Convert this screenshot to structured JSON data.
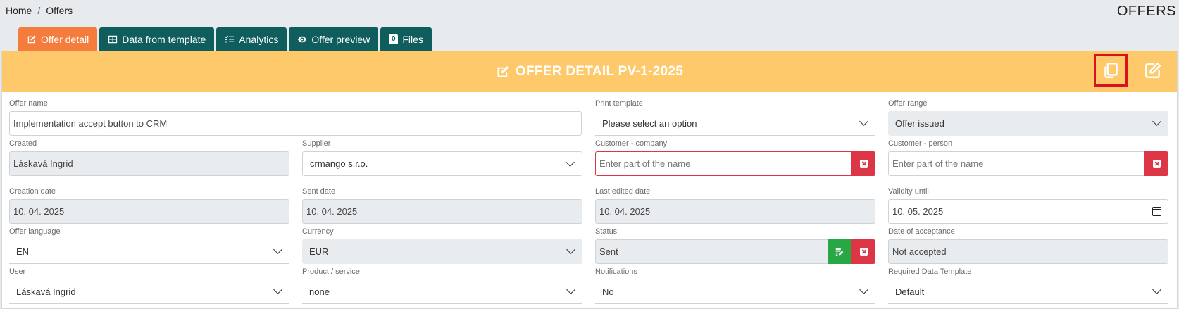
{
  "breadcrumb": {
    "home": "Home",
    "separator": "/",
    "current": "Offers"
  },
  "page_title": "OFFERS",
  "tabs": [
    {
      "label": "Offer detail",
      "icon": "edit-icon",
      "active": true
    },
    {
      "label": "Data from template",
      "icon": "table-icon",
      "active": false
    },
    {
      "label": "Analytics",
      "icon": "list-check-icon",
      "active": false
    },
    {
      "label": "Offer preview",
      "icon": "eye-icon",
      "active": false
    },
    {
      "label": "Files",
      "icon": "files-badge",
      "badge": "0",
      "active": false
    }
  ],
  "header": {
    "title": "OFFER DETAIL PV-1-2025",
    "background": "#fec96a",
    "actions": [
      {
        "icon": "copy-icon",
        "focused": true
      },
      {
        "icon": "external-edit-icon",
        "focused": false
      }
    ]
  },
  "form": {
    "offer_name": {
      "label": "Offer name",
      "value": "Implementation accept button to CRM"
    },
    "print_template": {
      "label": "Print template",
      "value": "Please select an option"
    },
    "offer_range": {
      "label": "Offer range",
      "value": "Offer issued"
    },
    "created": {
      "label": "Created",
      "value": "Láskavá Ingrid"
    },
    "supplier": {
      "label": "Supplier",
      "value": "crmango s.r.o."
    },
    "customer_company": {
      "label": "Customer - company",
      "placeholder": "Enter part of the name"
    },
    "customer_person": {
      "label": "Customer - person",
      "placeholder": "Enter part of the name"
    },
    "creation_date": {
      "label": "Creation date",
      "value": "10. 04. 2025"
    },
    "sent_date": {
      "label": "Sent date",
      "value": "10. 04. 2025"
    },
    "last_edited_date": {
      "label": "Last edited date",
      "value": "10. 04. 2025"
    },
    "validity_until": {
      "label": "Validity until",
      "value": "10. 05. 2025"
    },
    "offer_language": {
      "label": "Offer language",
      "value": "EN"
    },
    "currency": {
      "label": "Currency",
      "value": "EUR"
    },
    "status": {
      "label": "Status",
      "value": "Sent"
    },
    "date_of_acceptance": {
      "label": "Date of acceptance",
      "value": "Not accepted"
    },
    "user": {
      "label": "User",
      "value": "Láskavá Ingrid"
    },
    "product_service": {
      "label": "Product / service",
      "value": "none"
    },
    "notifications": {
      "label": "Notifications",
      "value": "No"
    },
    "required_data_template": {
      "label": "Required Data Template",
      "value": "Default"
    }
  },
  "colors": {
    "accent": "#f47c3c",
    "tab": "#0f5d5d",
    "danger": "#dc3545",
    "success": "#28a745"
  }
}
